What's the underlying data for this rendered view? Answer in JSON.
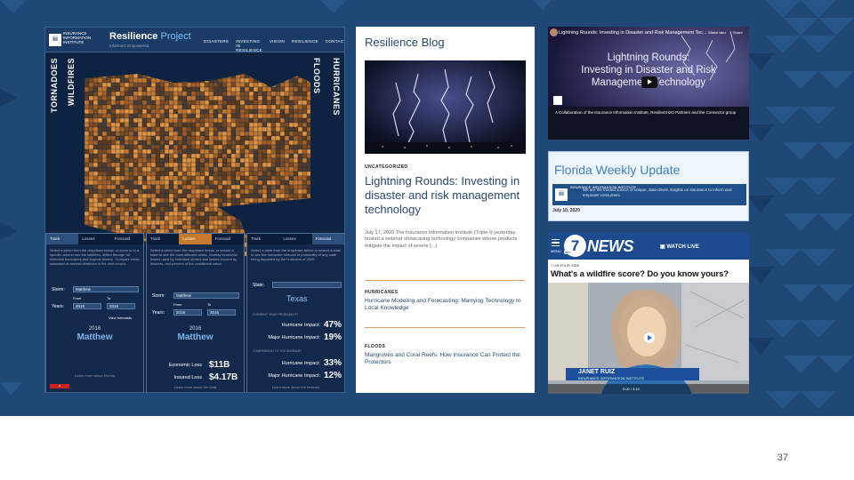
{
  "slide": {
    "page_number": "37"
  },
  "resilience_project": {
    "org_lines": "INSURANCE INFORMATION INSTITUTE",
    "logo": "iii",
    "title_main": "Resilience",
    "title_sub": "Project",
    "tagline": "Informed. Empowered.",
    "nav": [
      "DISASTERS",
      "INVESTING IN RESILIENCE",
      "VISION",
      "RESILIENCE",
      "CONTACT"
    ],
    "side_labels": {
      "left_outer": "TORNADOES",
      "left_inner": "WILDFIRES",
      "right_inner": "FLOODS",
      "right_outer": "HURRICANES"
    },
    "panels": [
      {
        "tabs": [
          "Track",
          "Losses",
          "Forecast"
        ],
        "active_tab": 0,
        "text": "Select a storm from the dropdown below, or zoom in to a specific area to see the wildfires, drilled through 'all historical hurricanes and tropical storms'. Compare totals assessed at several stretches in the next record.",
        "storm_label": "Storm:",
        "storm_value": "Matthew",
        "from_label": "From",
        "to_label": "To",
        "years_label": "Years:",
        "year_from": "2016",
        "year_to": "2016",
        "view_forecasts": "View forecasts",
        "year": "2016",
        "name": "Matthew",
        "footer": "Learn more about Florida"
      },
      {
        "tabs": [
          "Track",
          "Losses",
          "Forecast"
        ],
        "active_tab": 1,
        "text": "Select a storm from the dropdown below, or search a state to see the most affected areas. Overlay economic losses used by individual storms and losses insured by insurers, and percent of the conditional value.",
        "storm_label": "Storm:",
        "storm_value": "Matthew",
        "from_label": "From",
        "to_label": "To",
        "years_label": "Years:",
        "year_from": "2016",
        "year_to": "2016",
        "year": "2016",
        "name": "Matthew",
        "economic_label": "Economic Loss",
        "economic_value": "$11B",
        "insured_label": "Insured Loss",
        "insured_value": "$4.17B",
        "footer": "Learn more about the data"
      },
      {
        "tabs": [
          "Track",
          "Losses",
          "Forecast"
        ],
        "active_tab": 2,
        "text": "Select a state from the dropdown below or search a state to see the hurricane forecast of probability of any state being impacted by the hurricane of 2020.",
        "state_label": "State:",
        "state_value": "Texas",
        "section1": "CURRENT YEAR PROBABILITY",
        "hurricane_label": "Hurricane Impact:",
        "hurricane_value": "47%",
        "major_label": "Major Hurricane Impact:",
        "major_value": "19%",
        "section2": "COMPARISON TO THE AVERAGE",
        "hurricane2_value": "33%",
        "major2_value": "12%",
        "footer": "Learn more about the forecast"
      }
    ]
  },
  "blog": {
    "title": "Resilience Blog",
    "image_alt": "lightning over city at night",
    "post": {
      "category": "UNCATEGORIZED",
      "title": "Lightning Rounds: Investing in disaster and risk management technology",
      "excerpt": "July 17, 2020 The Insurance Information Institute (Triple-I) yesterday hosted a webinar showcasing technology companies whose products mitigate the impact of severe [...]"
    },
    "posts": [
      {
        "category": "HURRICANES",
        "title": "Hurricane Modeling and Forecasting: Marrying Technology to Local Knowledge"
      },
      {
        "category": "FLOODS",
        "title": "Mangroves and Coral Reefs: How Insurance Can Protect the Protectors"
      }
    ]
  },
  "webinar_video": {
    "top_title": "Lightning Rounds: Investing in Disaster and Risk Management Tec...",
    "watch_later": "Watch later",
    "share": "Share",
    "headline_lines": [
      "Lightning Rounds:",
      "Investing in Disaster and Risk",
      "Management Technology"
    ],
    "caption": "A Collaboration of the Insurance Information Institute, ResilientH2O Partners and the Connector group"
  },
  "florida_update": {
    "title": "Florida Weekly Update",
    "brand": "INSURANCE INFORMATION INSTITUTE",
    "bar_text": "We are the trusted source of unique, data-driven insights on insurance to inform and empower consumers.",
    "date": "July 10, 2020"
  },
  "news": {
    "menu": "MENU",
    "station_number": "7",
    "network": "abc",
    "brand": "NEWS",
    "watch_live": "WATCH LIVE",
    "section": "7 ON YOUR SIDE",
    "headline": "What's a wildfire score? Do you know yours?",
    "lower_third_name": "JANET RUIZ",
    "lower_third_org": "INSURANCE INFORMATION INSTITUTE",
    "time": "0:00 / 3:10"
  }
}
